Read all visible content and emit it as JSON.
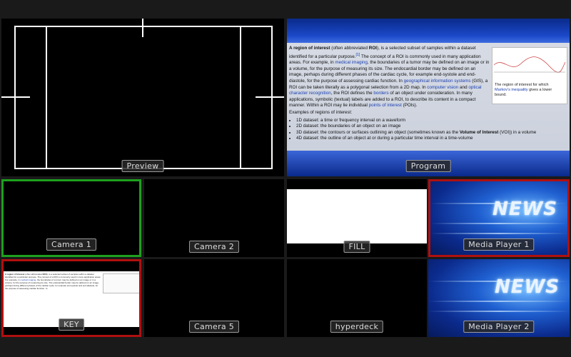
{
  "tiles": {
    "preview": "Preview",
    "program": "Program",
    "camera1": "Camera 1",
    "camera2": "Camera 2",
    "fill": "FILL",
    "media_player1": "Media Player 1",
    "key": "KEY",
    "camera5": "Camera 5",
    "hyperdeck": "hyperdeck",
    "media_player2": "Media Player 2"
  },
  "wiki": {
    "p1_b": "A region of interest",
    "p1_a": " (often abbreviated ",
    "p1_roi": "ROI",
    "p1_c": "), is a selected subset of samples within a dataset identified for a particular purpose.",
    "p1_ref": "[1]",
    "p1_d": " The concept of a ROI is commonly used in many application areas. For example, in ",
    "p1_link1": "medical imaging",
    "p1_e": ", the boundaries of a tumor may be defined on an image or in a volume, for the purpose of measuring its size. The endocardial border may be defined on an image, perhaps during different phases of the cardiac cycle, for example end-systole and end-diastole, for the purpose of assessing cardiac function. In ",
    "p1_link2": "geographical information systems",
    "p1_f": " (GIS), a ROI can be taken literally as a polygonal selection from a 2D map. In ",
    "p1_link3": "computer vision",
    "p1_g": " and ",
    "p1_link4": "optical character recognition",
    "p1_h": ", the ROI defines the ",
    "p1_link5": "borders",
    "p1_i": " of an object under consideration. In many applications, symbolic (textual) labels are added to a ROI, to describe its content in a compact manner. Within a ROI may lie individual ",
    "p1_link6": "points of interest",
    "p1_j": " (POIs).",
    "examples_heading": "Examples of regions of interest:",
    "bullet1": "1D dataset: a time or frequency interval on a waveform",
    "bullet2": "2D dataset: the boundaries of an object on an image",
    "bullet3_a": "3D dataset: the contours or surfaces outlining an object (sometimes known as the ",
    "bullet3_b": "Volume of Interest",
    "bullet3_c": " (VOI)) in a volume",
    "bullet4": "4D dataset: the outline of an object at or during a particular time interval in a time-volume",
    "fig_caption_a": "The region of interest for which ",
    "fig_caption_link": "Markov's inequality",
    "fig_caption_b": " gives a lower bound."
  },
  "news_text": "NEWS",
  "colors": {
    "camera1_border": "#1ea01e",
    "program_border": "#b01010",
    "tile_gap": "#8a8a8a"
  }
}
